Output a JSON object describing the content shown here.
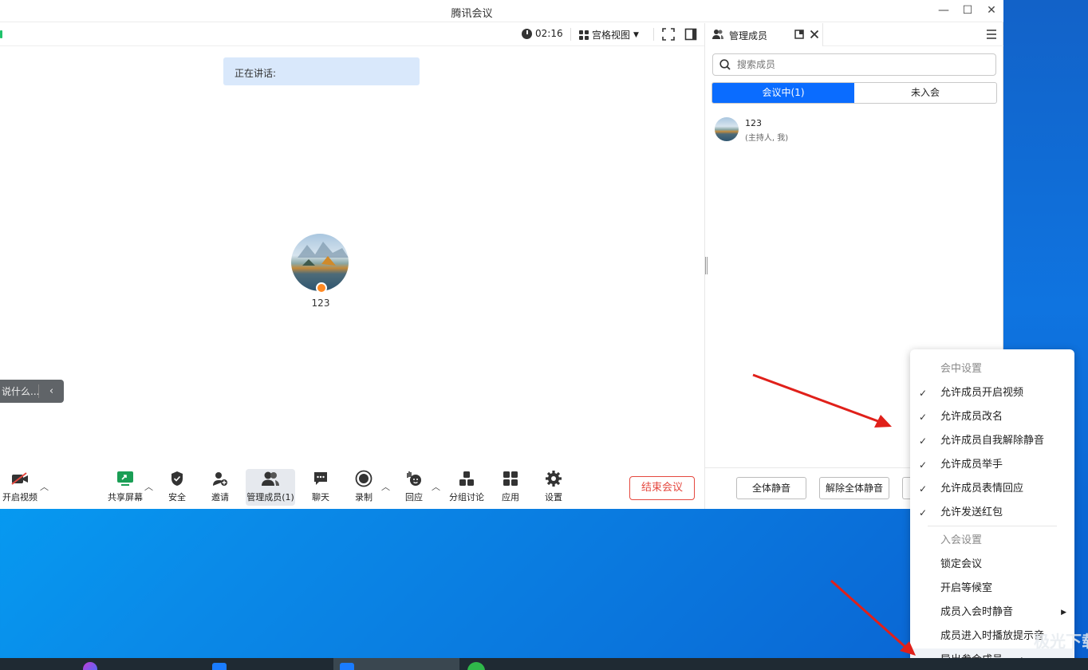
{
  "app": {
    "title": "腾讯会议"
  },
  "window_controls": {
    "minimize": "—",
    "maximize": "☐",
    "close": "✕"
  },
  "topbar": {
    "timer": "02:16",
    "view_label": "宫格视图"
  },
  "speaking": {
    "label": "正在讲话:"
  },
  "participant": {
    "name": "123"
  },
  "chat_input": {
    "placeholder": "说什么..."
  },
  "toolbar": {
    "video": "开启视频",
    "share": "共享屏幕",
    "security": "安全",
    "invite": "邀请",
    "members": "管理成员(1)",
    "chat": "聊天",
    "record": "录制",
    "react": "回应",
    "breakout": "分组讨论",
    "apps": "应用",
    "settings": "设置",
    "end": "结束会议"
  },
  "panel": {
    "title": "管理成员",
    "search_placeholder": "搜索成员",
    "tabs": [
      {
        "label": "会议中(1)",
        "active": true
      },
      {
        "label": "未入会",
        "active": false
      }
    ],
    "members": [
      {
        "name": "123",
        "role": "(主持人, 我)"
      }
    ],
    "footer": {
      "mute_all": "全体静音",
      "unmute_all": "解除全体静音"
    }
  },
  "menu": {
    "section1": "会中设置",
    "items1": [
      {
        "label": "允许成员开启视频",
        "checked": true
      },
      {
        "label": "允许成员改名",
        "checked": true
      },
      {
        "label": "允许成员自我解除静音",
        "checked": true
      },
      {
        "label": "允许成员举手",
        "checked": true
      },
      {
        "label": "允许成员表情回应",
        "checked": true
      },
      {
        "label": "允许发送红包",
        "checked": true
      }
    ],
    "section2": "入会设置",
    "items2": [
      {
        "label": "锁定会议"
      },
      {
        "label": "开启等候室"
      },
      {
        "label": "成员入会时静音",
        "submenu": true
      },
      {
        "label": "成员进入时播放提示音"
      },
      {
        "label": "导出参会成员"
      }
    ]
  },
  "watermark": "极光下载站",
  "colors": {
    "accent": "#0a6cff",
    "danger": "#e5483f",
    "speaking_bg": "#d9e8fb",
    "arrow": "#e0201a"
  }
}
